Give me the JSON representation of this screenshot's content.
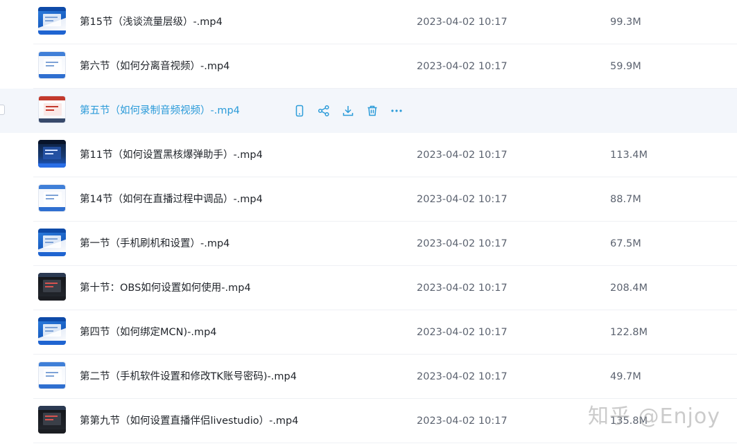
{
  "files": [
    {
      "name": "第15节（浅谈流量层级）-.mp4",
      "date": "2023-04-02 10:17",
      "size": "99.3M",
      "thumb": "blue"
    },
    {
      "name": "第六节（如何分离音视频）-.mp4",
      "date": "2023-04-02 10:17",
      "size": "59.9M",
      "thumb": "light"
    },
    {
      "name": "第五节（如何录制音频视频）-.mp4",
      "date": "",
      "size": "",
      "thumb": "red"
    },
    {
      "name": "第11节（如何设置黑核爆弹助手）-.mp4",
      "date": "2023-04-02 10:17",
      "size": "113.4M",
      "thumb": "dark"
    },
    {
      "name": "第14节（如何在直播过程中调品）-.mp4",
      "date": "2023-04-02 10:17",
      "size": "88.7M",
      "thumb": "light"
    },
    {
      "name": "第一节（手机刷机和设置）-.mp4",
      "date": "2023-04-02 10:17",
      "size": "67.5M",
      "thumb": "blue"
    },
    {
      "name": "第十节：OBS如何设置如何使用-.mp4",
      "date": "2023-04-02 10:17",
      "size": "208.4M",
      "thumb": "black"
    },
    {
      "name": "第四节（如何绑定MCN)-.mp4",
      "date": "2023-04-02 10:17",
      "size": "122.8M",
      "thumb": "blue"
    },
    {
      "name": "第二节（手机软件设置和修改TK账号密码)-.mp4",
      "date": "2023-04-02 10:17",
      "size": "49.7M",
      "thumb": "light"
    },
    {
      "name": "第第九节（如何设置直播伴侣livestudio）-.mp4",
      "date": "2023-04-02 10:17",
      "size": "135.8M",
      "thumb": "black"
    }
  ],
  "hover_actions": [
    {
      "icon": "phone-icon"
    },
    {
      "icon": "share-icon"
    },
    {
      "icon": "download-icon"
    },
    {
      "icon": "trash-icon"
    },
    {
      "icon": "more-icon"
    }
  ],
  "colors": {
    "accent": "#2b9bd9",
    "hover_bg": "#f3f6fb"
  },
  "watermark": "知乎 @Enjoy"
}
